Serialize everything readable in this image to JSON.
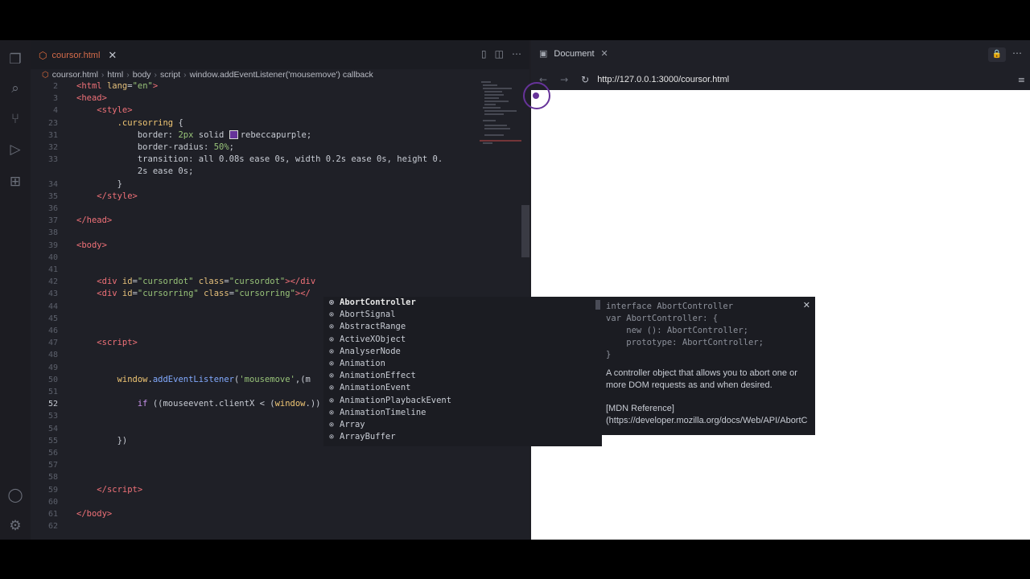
{
  "editor": {
    "tab_label": "coursor.html",
    "breadcrumb": [
      "coursor.html",
      "html",
      "body",
      "script",
      "window.addEventListener('mousemove') callback"
    ],
    "lines": [
      {
        "n": "2",
        "html": "<span class=\"tag\">&lt;html</span> <span class=\"attr\">lang</span>=<span class=\"str\">\"en\"</span><span class=\"tag\">&gt;</span>"
      },
      {
        "n": "3",
        "html": "<span class=\"tag\">&lt;head&gt;</span>"
      },
      {
        "n": "4",
        "html": "    <span class=\"tag\">&lt;style&gt;</span>"
      },
      {
        "n": "23",
        "html": "        <span class=\"var\">.cursorring</span> {"
      },
      {
        "n": "31",
        "html": "            <span class=\"prop\">border</span>: <span class=\"str\">2px</span> solid <span class=\"swatch\"></span>rebeccapurple;"
      },
      {
        "n": "32",
        "html": "            <span class=\"prop\">border-radius</span>: <span class=\"str\">50%</span>;"
      },
      {
        "n": "33",
        "html": "            <span class=\"prop\">transition</span>: all 0.08s ease 0s, width 0.2s ease 0s, height 0."
      },
      {
        "n": "",
        "html": "            2s ease 0s;"
      },
      {
        "n": "34",
        "html": "        }"
      },
      {
        "n": "35",
        "html": "    <span class=\"tag\">&lt;/style&gt;</span>"
      },
      {
        "n": "36",
        "html": ""
      },
      {
        "n": "37",
        "html": "<span class=\"tag\">&lt;/head&gt;</span>"
      },
      {
        "n": "38",
        "html": ""
      },
      {
        "n": "39",
        "html": "<span class=\"tag\">&lt;body&gt;</span>"
      },
      {
        "n": "40",
        "html": ""
      },
      {
        "n": "41",
        "html": ""
      },
      {
        "n": "42",
        "html": "    <span class=\"tag\">&lt;div</span> <span class=\"attr\">id</span>=<span class=\"str\">\"cursordot\"</span> <span class=\"attr\">class</span>=<span class=\"str\">\"cursordot\"</span><span class=\"tag\">&gt;&lt;/div</span>"
      },
      {
        "n": "43",
        "html": "    <span class=\"tag\">&lt;div</span> <span class=\"attr\">id</span>=<span class=\"str\">\"cursorring\"</span> <span class=\"attr\">class</span>=<span class=\"str\">\"cursorring\"</span><span class=\"tag\">&gt;&lt;/</span>"
      },
      {
        "n": "44",
        "html": ""
      },
      {
        "n": "45",
        "html": ""
      },
      {
        "n": "46",
        "html": ""
      },
      {
        "n": "47",
        "html": "    <span class=\"tag\">&lt;script&gt;</span>"
      },
      {
        "n": "48",
        "html": ""
      },
      {
        "n": "49",
        "html": ""
      },
      {
        "n": "50",
        "html": "        <span class=\"var\">window</span>.<span class=\"fn\">addEventListener</span>(<span class=\"str\">'mousemove'</span>,(m"
      },
      {
        "n": "51",
        "html": ""
      },
      {
        "n": "52",
        "html": "            <span class=\"kw\">if</span> ((mouseevent.clientX &lt; (<span class=\"var\">window</span>.))"
      },
      {
        "n": "53",
        "html": ""
      },
      {
        "n": "54",
        "html": ""
      },
      {
        "n": "55",
        "html": "        })"
      },
      {
        "n": "56",
        "html": ""
      },
      {
        "n": "57",
        "html": ""
      },
      {
        "n": "58",
        "html": ""
      },
      {
        "n": "59",
        "html": "    <span class=\"tag\">&lt;/script&gt;</span>"
      },
      {
        "n": "60",
        "html": ""
      },
      {
        "n": "61",
        "html": "<span class=\"tag\">&lt;/body&gt;</span>"
      },
      {
        "n": "62",
        "html": ""
      }
    ]
  },
  "browser": {
    "tab_label": "Document",
    "url": "http://127.0.0.1:3000/coursor.html"
  },
  "suggest": {
    "items": [
      "AbortController",
      "AbortSignal",
      "AbstractRange",
      "ActiveXObject",
      "AnalyserNode",
      "Animation",
      "AnimationEffect",
      "AnimationEvent",
      "AnimationPlaybackEvent",
      "AnimationTimeline",
      "Array",
      "ArrayBuffer"
    ],
    "detail_signature": "interface AbortController\nvar AbortController: {\n    new (): AbortController;\n    prototype: AbortController;\n}",
    "detail_doc": "A controller object that allows you to abort one or more DOM requests as and when desired.",
    "detail_ref_title": "[MDN Reference]",
    "detail_ref_link": "(https://developer.mozilla.org/docs/Web/API/AbortC"
  },
  "colors": {
    "accent": "#663399",
    "tag": "#f07178",
    "string": "#98c379"
  }
}
